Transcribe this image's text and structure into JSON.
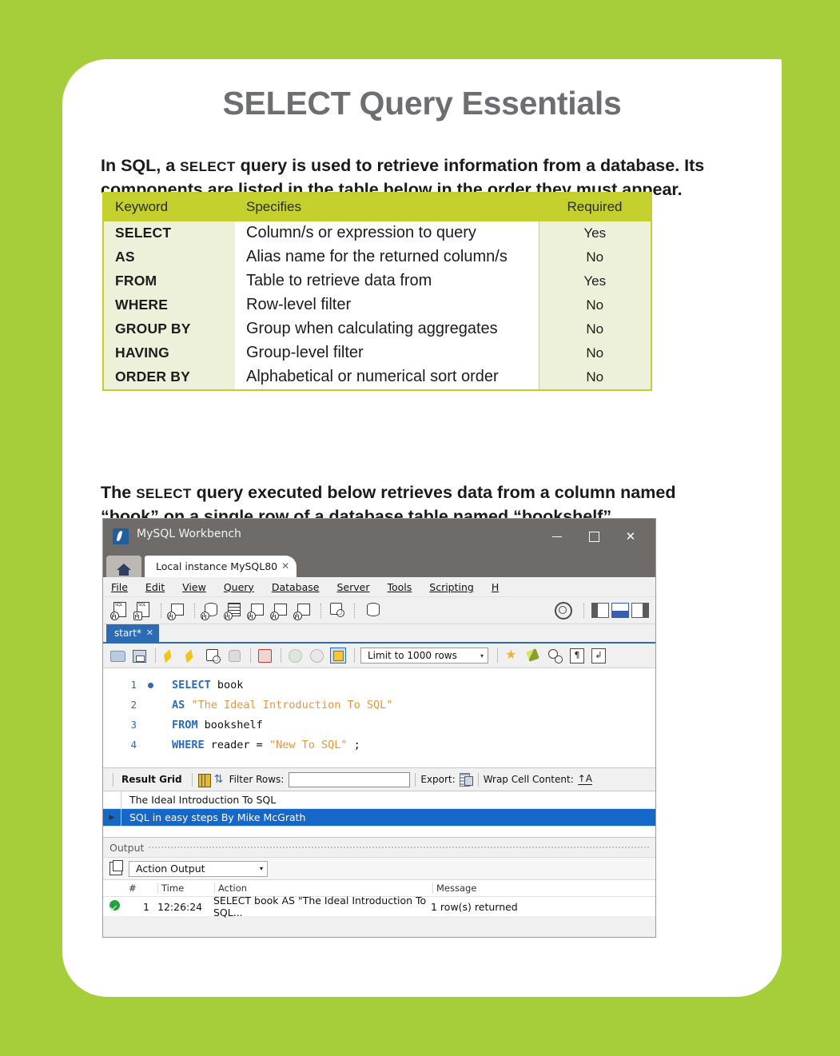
{
  "theme": {
    "background": "#a5ce3a",
    "card": "#ffffff",
    "table_header": "#c3d02e",
    "table_tint": "#eef1da",
    "title_color": "#6d6e71",
    "selection_blue": "#1568c8",
    "sql_keyword": "#2d6cb5",
    "sql_string": "#e8963a"
  },
  "page": {
    "title": "SELECT Query Essentials",
    "intro_pre": "In SQL, a ",
    "intro_kw": "SELECT",
    "intro_post": " query is used to retrieve information from a database. Its components are listed in the table below in the order they must appear.",
    "exec_pre": "The ",
    "exec_kw": "SELECT",
    "exec_post": " query executed below retrieves data from a column named “book” on a single row of a database table named “bookshelf”."
  },
  "keyword_table": {
    "headers": [
      "Keyword",
      "Specifies",
      "Required"
    ],
    "rows": [
      {
        "keyword": "SELECT",
        "specifies": "Column/s or expression to query",
        "required": "Yes"
      },
      {
        "keyword": "AS",
        "specifies": "Alias name for the returned column/s",
        "required": "No"
      },
      {
        "keyword": "FROM",
        "specifies": "Table to retrieve data from",
        "required": "Yes"
      },
      {
        "keyword": "WHERE",
        "specifies": "Row-level filter",
        "required": "No"
      },
      {
        "keyword": "GROUP BY",
        "specifies": "Group when calculating aggregates",
        "required": "No"
      },
      {
        "keyword": "HAVING",
        "specifies": "Group-level filter",
        "required": "No"
      },
      {
        "keyword": "ORDER BY",
        "specifies": "Alphabetical or numerical sort order",
        "required": "No"
      }
    ]
  },
  "workbench": {
    "titlebar": {
      "app_title": "MySQL Workbench",
      "minimize": "—",
      "maximize": "□",
      "close": "✕"
    },
    "tabs": {
      "home_icon": "home-icon",
      "instance_tab": "Local instance MySQL80",
      "instance_tab_close": "✕"
    },
    "menu": [
      "File",
      "Edit",
      "View",
      "Query",
      "Database",
      "Server",
      "Tools",
      "Scripting",
      "H"
    ],
    "editor_tab": {
      "label": "start*",
      "close": "✕"
    },
    "sql_toolbar": {
      "limit_value": "Limit to 1000 rows",
      "caret": "▾"
    },
    "code": [
      {
        "num": "1",
        "breakpoint": true,
        "tokens": [
          {
            "t": "kw",
            "v": "SELECT"
          },
          {
            "t": "sp",
            "v": " "
          },
          {
            "t": "id",
            "v": "book"
          }
        ]
      },
      {
        "num": "2",
        "breakpoint": false,
        "tokens": [
          {
            "t": "kw",
            "v": "AS"
          },
          {
            "t": "sp",
            "v": " "
          },
          {
            "t": "str",
            "v": "\"The Ideal Introduction To SQL\""
          }
        ]
      },
      {
        "num": "3",
        "breakpoint": false,
        "tokens": [
          {
            "t": "kw",
            "v": "FROM"
          },
          {
            "t": "sp",
            "v": " "
          },
          {
            "t": "id",
            "v": "bookshelf"
          }
        ]
      },
      {
        "num": "4",
        "breakpoint": false,
        "tokens": [
          {
            "t": "kw",
            "v": "WHERE"
          },
          {
            "t": "sp",
            "v": " "
          },
          {
            "t": "id",
            "v": "reader = "
          },
          {
            "t": "str",
            "v": "\"New To SQL\""
          },
          {
            "t": "id",
            "v": " ;"
          }
        ]
      }
    ],
    "result_bar": {
      "result_grid_label": "Result Grid",
      "filter_rows_label": "Filter Rows:",
      "filter_value": "",
      "export_label": "Export:",
      "wrap_label": "Wrap Cell Content:",
      "wrap_icon_text": "↑A"
    },
    "result_grid": {
      "column_header": "The Ideal Introduction To SQL",
      "rows": [
        {
          "marker": "▶",
          "value": "SQL in easy steps By Mike McGrath",
          "selected": true
        }
      ]
    },
    "output": {
      "section_label": "Output",
      "selector_value": "Action Output",
      "selector_caret": "▾",
      "headers": [
        "#",
        "Time",
        "Action",
        "Message"
      ],
      "rows": [
        {
          "status": "success",
          "num": "1",
          "time": "12:26:24",
          "action": "SELECT book AS \"The Ideal Introduction To SQL...",
          "message": "1 row(s) returned"
        }
      ]
    }
  }
}
